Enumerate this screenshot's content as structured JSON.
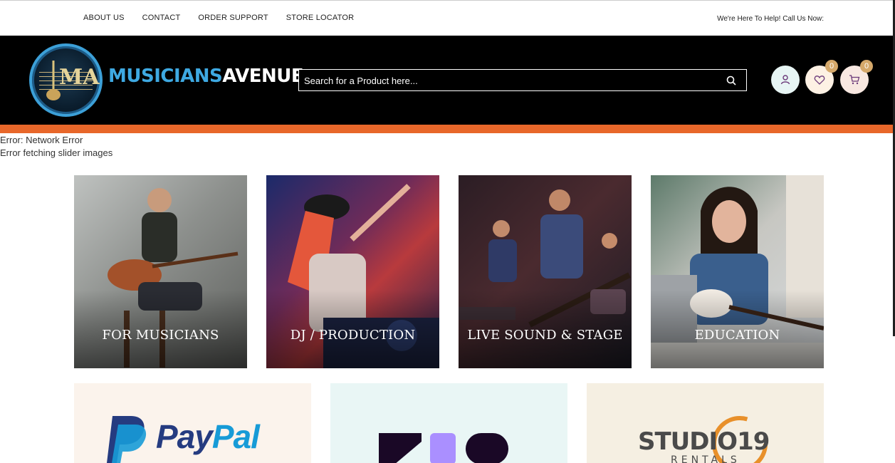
{
  "topbar": {
    "nav": [
      "ABOUT US",
      "CONTACT",
      "ORDER SUPPORT",
      "STORE LOCATOR"
    ],
    "help_text": "We're Here To Help! Call Us Now:"
  },
  "header": {
    "logo": {
      "word1": "MUSICIANS",
      "word2": "AVENUE",
      "emblem_text": "MA"
    },
    "search": {
      "placeholder": "Search for a Product here...",
      "value": ""
    },
    "wishlist_count": "0",
    "cart_count": "0"
  },
  "errors": [
    "Error: Network Error",
    "Error fetching slider images"
  ],
  "categories": [
    {
      "label": "FOR MUSICIANS"
    },
    {
      "label": "DJ / PRODUCTION"
    },
    {
      "label": "LIVE SOUND & STAGE"
    },
    {
      "label": "EDUCATION"
    }
  ],
  "partners": [
    {
      "name": "PayPal"
    },
    {
      "name": "zip"
    },
    {
      "name": "STUDIO19",
      "sub": "RENTALS"
    }
  ],
  "colors": {
    "accent_orange": "#e8672a",
    "logo_blue": "#3ea9e2",
    "paypal_dark": "#253b80",
    "paypal_light": "#179bd7",
    "zip_purple": "#aa8fff",
    "studio_orange": "#e8902a"
  },
  "icons": [
    "search-icon",
    "user-icon",
    "heart-icon",
    "cart-icon"
  ]
}
